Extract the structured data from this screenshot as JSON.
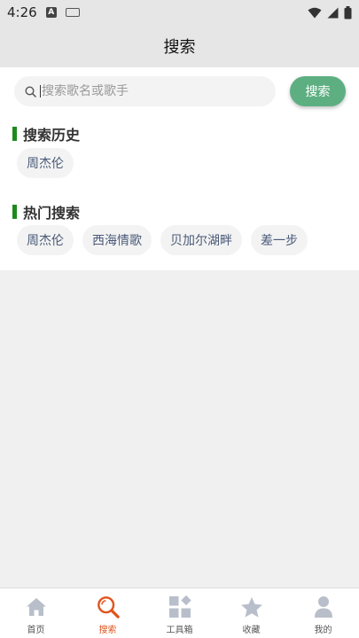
{
  "status_bar": {
    "time": "4:26",
    "a_icon": "A"
  },
  "header": {
    "title": "搜索"
  },
  "search": {
    "placeholder": "搜索歌名或歌手",
    "value": "",
    "button_label": "搜索"
  },
  "history": {
    "title": "搜索历史",
    "items": [
      "周杰伦"
    ]
  },
  "hot": {
    "title": "热门搜索",
    "items": [
      "周杰伦",
      "西海情歌",
      "贝加尔湖畔",
      "差一步"
    ]
  },
  "tabs": [
    {
      "label": "首页",
      "icon": "home-icon"
    },
    {
      "label": "搜索",
      "icon": "search-icon",
      "active": true
    },
    {
      "label": "工具箱",
      "icon": "toolbox-icon"
    },
    {
      "label": "收藏",
      "icon": "star-icon"
    },
    {
      "label": "我的",
      "icon": "user-icon"
    }
  ],
  "colors": {
    "accent": "#5daf82",
    "section_bar": "#1d8a1d",
    "active_tab": "#e0531d",
    "inactive_tab_icon": "#b8bfca",
    "chip_text": "#4a5a78"
  }
}
